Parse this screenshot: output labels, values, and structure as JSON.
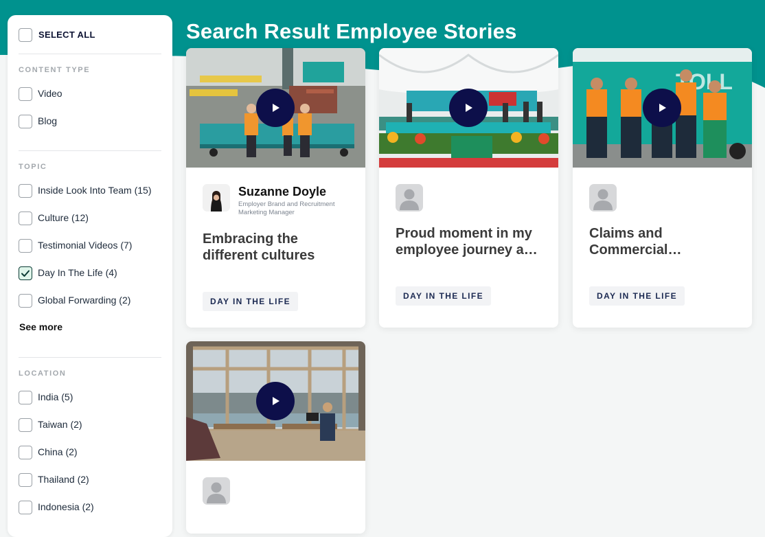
{
  "page": {
    "title": "Search Result Employee Stories"
  },
  "colors": {
    "accent": "#00928e",
    "play_button": "#0d0f4a"
  },
  "sidebar": {
    "select_all": "SELECT ALL",
    "content_type": {
      "title": "CONTENT TYPE",
      "options": [
        {
          "label": "Video",
          "checked": false
        },
        {
          "label": "Blog",
          "checked": false
        }
      ]
    },
    "topic": {
      "title": "TOPIC",
      "options": [
        {
          "label": "Inside Look Into Team (15)",
          "checked": false
        },
        {
          "label": "Culture (12)",
          "checked": false
        },
        {
          "label": "Testimonial Videos (7)",
          "checked": false
        },
        {
          "label": "Day In The Life (4)",
          "checked": true
        },
        {
          "label": "Global Forwarding (2)",
          "checked": false
        }
      ],
      "see_more": "See more"
    },
    "location": {
      "title": "LOCATION",
      "options": [
        {
          "label": "India (5)",
          "checked": false
        },
        {
          "label": "Taiwan (2)",
          "checked": false
        },
        {
          "label": "China (2)",
          "checked": false
        },
        {
          "label": "Thailand (2)",
          "checked": false
        },
        {
          "label": "Indonesia (2)",
          "checked": false
        }
      ]
    }
  },
  "cards": [
    {
      "image": "warehouse-team-photo",
      "author_name": "Suzanne Doyle",
      "author_role": "Employer Brand and Recruitment Marketing Manager",
      "title": "Embracing the different cultures",
      "tag": "DAY IN THE LIFE"
    },
    {
      "image": "ceremony-stage-photo",
      "title": "Proud moment in my employee journey a…",
      "tag": "DAY IN THE LIFE"
    },
    {
      "image": "workers-hi-vis-photo",
      "title": "Claims and Commercial…",
      "tag": "DAY IN THE LIFE"
    },
    {
      "image": "office-window-photo"
    }
  ]
}
